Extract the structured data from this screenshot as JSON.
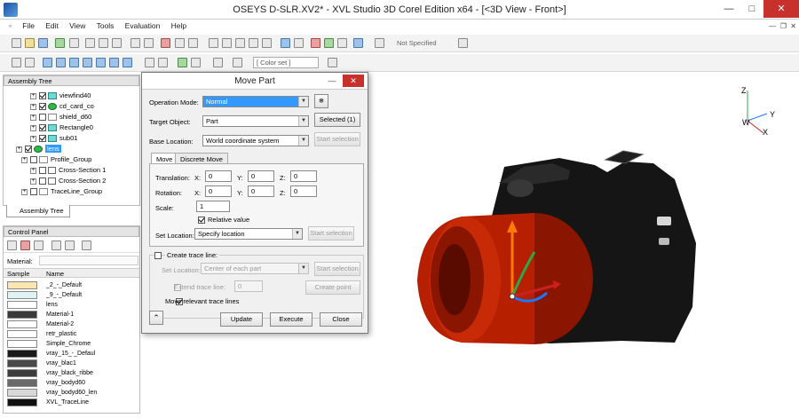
{
  "app": {
    "title": "OSEYS D-SLR.XV2* - XVL Studio 3D Corel Edition x64 - [<3D View - Front>]",
    "window_buttons": {
      "minimize": "—",
      "maximize": "□",
      "close": "✕"
    }
  },
  "menu": [
    "File",
    "Edit",
    "View",
    "Tools",
    "Evaluation",
    "Help"
  ],
  "toolbar1": {
    "spec_combo": "Not Specified"
  },
  "toolbar2": {
    "color_combo": "[ Color set ]"
  },
  "assembly_tree": {
    "header": "Assembly Tree",
    "items": [
      {
        "label": "viewfind40",
        "checked": true,
        "icon": "part-icon"
      },
      {
        "label": "cd_card_co",
        "checked": true,
        "icon": "part-green-icon"
      },
      {
        "label": "shield_d60",
        "checked": false,
        "icon": "part-outline-icon"
      },
      {
        "label": "Rectangle0",
        "checked": true,
        "icon": "part-icon"
      },
      {
        "label": "sub01",
        "checked": true,
        "icon": "part-icon"
      },
      {
        "label": "lens",
        "checked": true,
        "icon": "part-green-icon",
        "selected": true
      },
      {
        "label": "Profile_Group",
        "checked": false,
        "icon": "group-icon"
      },
      {
        "label": "Cross-Section 1",
        "checked": false,
        "icon": "section-icon"
      },
      {
        "label": "Cross-Section 2",
        "checked": false,
        "icon": "section-icon"
      },
      {
        "label": "TraceLine_Group",
        "checked": false,
        "icon": "traceline-icon"
      }
    ],
    "tab_label": "Assembly Tree"
  },
  "control_panel": {
    "header": "Control Panel",
    "material_label": "Material:",
    "col_sample": "Sample",
    "col_name": "Name",
    "materials": [
      {
        "name": "_2_-_Default",
        "color": "#fbe6b0"
      },
      {
        "name": "_9_-_Default",
        "color": "#dff3f4"
      },
      {
        "name": "lens",
        "color": "#ffffff"
      },
      {
        "name": "Material-1",
        "color": "#3a3a3a"
      },
      {
        "name": "Material-2",
        "color": "#ffffff"
      },
      {
        "name": "retr_plastic",
        "color": "#ffffff"
      },
      {
        "name": "Simple_Chrome",
        "color": "#ffffff"
      },
      {
        "name": "vray_15_-_Defaul",
        "color": "#1a1a1a"
      },
      {
        "name": "vray_blac1",
        "color": "#4a4a4a"
      },
      {
        "name": "vray_black_ribbe",
        "color": "#3c3c3c"
      },
      {
        "name": "vray_bodyd60",
        "color": "#6a6a6a"
      },
      {
        "name": "vray_bodyd60_len",
        "color": "#d8d8d8"
      },
      {
        "name": "XVL_TraceLine",
        "color": "#111111"
      }
    ]
  },
  "dialog": {
    "title": "Move Part",
    "operation_mode_label": "Operation Mode:",
    "operation_mode_value": "Normal",
    "target_object_label": "Target Object:",
    "target_object_value": "Part",
    "selected_button": "Selected (1)",
    "base_location_label": "Base Location:",
    "base_location_value": "World coordinate system",
    "start_selection": "Start selection",
    "tabs": [
      "Move",
      "Discrete Move"
    ],
    "translation_label": "Translation:",
    "rotation_label": "Rotation:",
    "scale_label": "Scale:",
    "x_label": "X:",
    "y_label": "Y:",
    "z_label": "Z:",
    "translation": [
      "0",
      "0",
      "0"
    ],
    "rotation": [
      "0",
      "0",
      "0"
    ],
    "scale": "1",
    "relative_value_label": "Relative value",
    "set_location_label": "Set Location:",
    "set_location_value": "Specify location",
    "create_trace_line_label": "Create trace line:",
    "trace_set_location_value": "Center of each part",
    "extend_trace_line_label": "Extend trace line:",
    "extend_trace_value": "0",
    "create_point": "Create point",
    "move_relevant_label": "Move relevant trace lines",
    "update": "Update",
    "execute": "Execute",
    "close": "Close"
  },
  "axes": {
    "z": "Z",
    "y": "Y",
    "w": "W",
    "x": "X"
  }
}
